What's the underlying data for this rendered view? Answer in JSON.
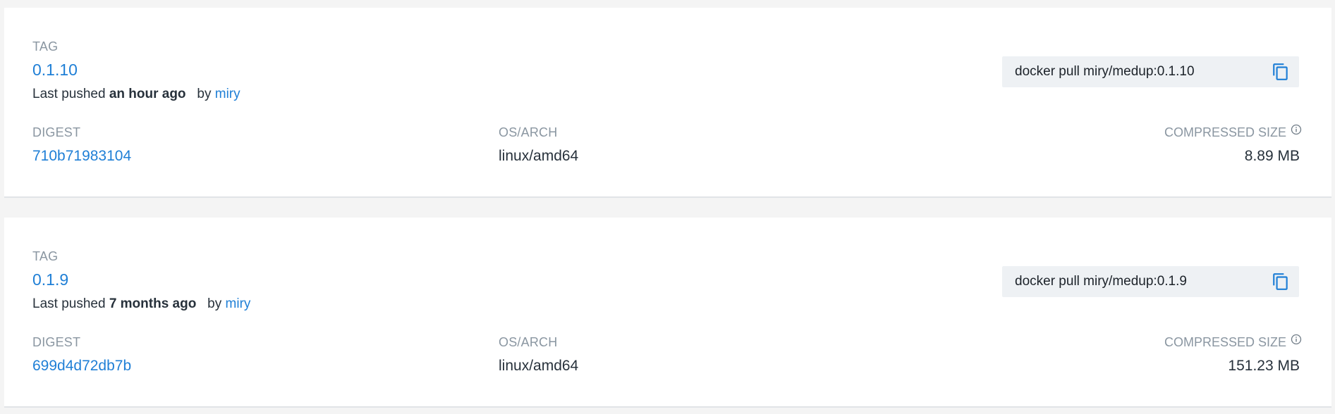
{
  "labels": {
    "tag": "TAG",
    "digest": "DIGEST",
    "os_arch": "OS/ARCH",
    "compressed_size": "COMPRESSED SIZE",
    "last_pushed": "Last pushed",
    "by": "by"
  },
  "icons": {
    "copy": "copy-icon",
    "info": "info-icon"
  },
  "colors": {
    "link": "#1f7fd6",
    "muted_label": "#8a96a1",
    "pull_box_bg": "#eef1f4"
  },
  "tags": [
    {
      "name": "0.1.10",
      "pushed_when": "an hour ago",
      "pushed_by": "miry",
      "pull_command": "docker pull miry/medup:0.1.10",
      "digest": "710b71983104",
      "os_arch": "linux/amd64",
      "compressed_size": "8.89 MB"
    },
    {
      "name": "0.1.9",
      "pushed_when": "7 months ago",
      "pushed_by": "miry",
      "pull_command": "docker pull miry/medup:0.1.9",
      "digest": "699d4d72db7b",
      "os_arch": "linux/amd64",
      "compressed_size": "151.23 MB"
    }
  ]
}
